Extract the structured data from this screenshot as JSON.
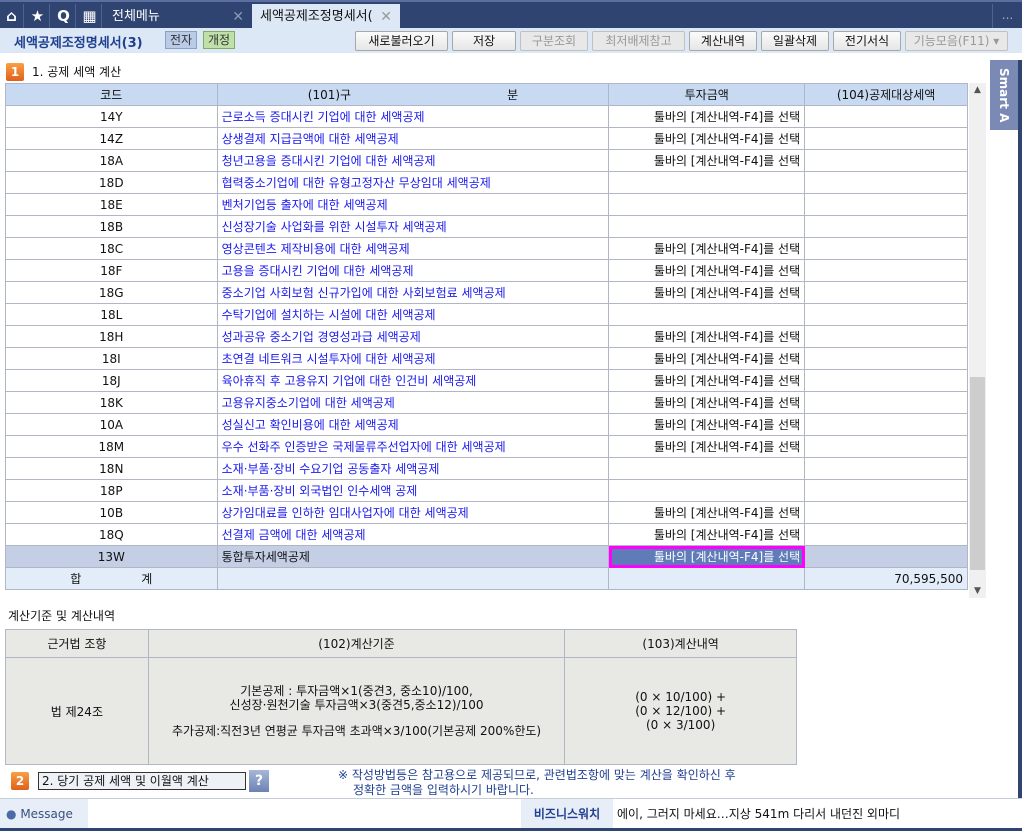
{
  "tabbar": {
    "icons": [
      "home-icon",
      "star-icon",
      "search-icon",
      "calendar-icon"
    ],
    "search_glyph": "Q",
    "tabs": [
      {
        "label": "전체메뉴"
      },
      {
        "label": "세액공제조정명세서("
      }
    ],
    "more": "..."
  },
  "toolbar": {
    "title": "세액공제조정명세서(3)",
    "badges": [
      "전자",
      "개정"
    ],
    "buttons": [
      {
        "label": "새로불러오기",
        "enabled": true
      },
      {
        "label": "저장",
        "enabled": true
      },
      {
        "label": "구분조회",
        "enabled": false
      },
      {
        "label": "최저배제참고",
        "enabled": false
      },
      {
        "label": "계산내역",
        "enabled": true
      },
      {
        "label": "일괄삭제",
        "enabled": true
      },
      {
        "label": "전기서식",
        "enabled": true
      },
      {
        "label": "기능모음(F11)",
        "enabled": false
      }
    ]
  },
  "smart_tab": "Smart A",
  "section1": {
    "num": "1",
    "title": "1. 공제 세액 계산",
    "headers": [
      "코드",
      "(101)구　　　　　　　　　　　　　분",
      "투자금액",
      "(104)공제대상세액"
    ],
    "rows": [
      {
        "code": "14Y",
        "item": "근로소득 증대시킨 기업에 대한 세액공제",
        "inv": "툴바의 [계산내역-F4]를 선택",
        "amt": ""
      },
      {
        "code": "14Z",
        "item": "상생결제 지급금액에 대한 세액공제",
        "inv": "툴바의 [계산내역-F4]를 선택",
        "amt": ""
      },
      {
        "code": "18A",
        "item": "청년고용을 증대시킨 기업에 대한 세액공제",
        "inv": "툴바의 [계산내역-F4]를 선택",
        "amt": ""
      },
      {
        "code": "18D",
        "item": "협력중소기업에 대한 유형고정자산 무상임대 세액공제",
        "inv": "",
        "amt": ""
      },
      {
        "code": "18E",
        "item": "벤처기업등 출자에 대한 세액공제",
        "inv": "",
        "amt": ""
      },
      {
        "code": "18B",
        "item": "신성장기술 사업화를 위한 시설투자 세액공제",
        "inv": "",
        "amt": ""
      },
      {
        "code": "18C",
        "item": "영상콘텐츠 제작비용에 대한 세액공제",
        "inv": "툴바의 [계산내역-F4]를 선택",
        "amt": ""
      },
      {
        "code": "18F",
        "item": "고용을 증대시킨 기업에 대한 세액공제",
        "inv": "툴바의 [계산내역-F4]를 선택",
        "amt": ""
      },
      {
        "code": "18G",
        "item": "중소기업 사회보험 신규가입에 대한 사회보험료 세액공제",
        "inv": "툴바의 [계산내역-F4]를 선택",
        "amt": ""
      },
      {
        "code": "18L",
        "item": "수탁기업에 설치하는 시설에 대한 세액공제",
        "inv": "",
        "amt": ""
      },
      {
        "code": "18H",
        "item": "성과공유 중소기업 경영성과급 세액공제",
        "inv": "툴바의 [계산내역-F4]를 선택",
        "amt": ""
      },
      {
        "code": "18I",
        "item": "초연결 네트워크 시설투자에 대한 세액공제",
        "inv": "툴바의 [계산내역-F4]를 선택",
        "amt": ""
      },
      {
        "code": "18J",
        "item": "육아휴직 후 고용유지 기업에 대한 인건비 세액공제",
        "inv": "툴바의 [계산내역-F4]를 선택",
        "amt": ""
      },
      {
        "code": "18K",
        "item": "고용유지중소기업에 대한 세액공제",
        "inv": "툴바의 [계산내역-F4]를 선택",
        "amt": ""
      },
      {
        "code": "10A",
        "item": "성실신고 확인비용에 대한 세액공제",
        "inv": "툴바의 [계산내역-F4]를 선택",
        "amt": ""
      },
      {
        "code": "18M",
        "item": "우수 선화주 인증받은 국제물류주선업자에 대한 세액공제",
        "inv": "툴바의 [계산내역-F4]를 선택",
        "amt": ""
      },
      {
        "code": "18N",
        "item": "소재·부품·장비 수요기업 공동출자 세액공제",
        "inv": "",
        "amt": ""
      },
      {
        "code": "18P",
        "item": "소재·부품·장비 외국법인 인수세액 공제",
        "inv": "",
        "amt": ""
      },
      {
        "code": "10B",
        "item": "상가임대료를 인하한 임대사업자에 대한 세액공제",
        "inv": "툴바의 [계산내역-F4]를 선택",
        "amt": ""
      },
      {
        "code": "18Q",
        "item": "선결제 금액에 대한 세액공제",
        "inv": "툴바의 [계산내역-F4]를 선택",
        "amt": ""
      },
      {
        "code": "13W",
        "item": "통합투자세액공제",
        "inv": "툴바의 [계산내역-F4]를 선택",
        "amt": "",
        "selected": true
      }
    ],
    "total": {
      "label": "합　　　　　계",
      "amt": "70,595,500"
    }
  },
  "calc": {
    "title": "계산기준 및 계산내역",
    "headers": [
      "근거법 조항",
      "(102)계산기준",
      "(103)계산내역"
    ],
    "law": "법 제24조",
    "basis": [
      "기본공제 : 투자금액×1(중견3, 중소10)/100,",
      "신성장·원천기술 투자금액×3(중견5,중소12)/100",
      "추가공제:직전3년 연평균 투자금액 초과액×3/100(기본공제 200%한도)"
    ],
    "detail": [
      "(0 × 10/100) +",
      "(0 × 12/100) +",
      "(0 × 3/100)"
    ]
  },
  "section2": {
    "num": "2",
    "value": "2. 당기 공제 세액 및 이월액 계산",
    "help": "?",
    "note": [
      "※ 작성방법등은 참고용으로 제공되므로, 관련법조항에 맞는 계산을 확인하신 후",
      "정확한 금액을 입력하시기 바랍니다."
    ]
  },
  "status": {
    "message": "Message",
    "biz_label": "비즈니스워치",
    "news": "에이, 그러지 마세요…지상 541m 다리서 내던진 외마디"
  }
}
